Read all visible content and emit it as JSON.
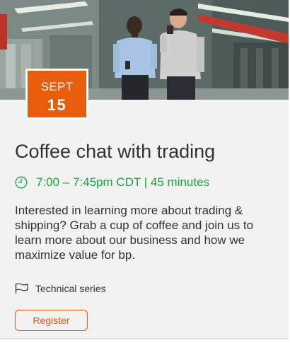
{
  "event": {
    "date": {
      "month": "SEPT",
      "day": "15"
    },
    "title": "Coffee chat with trading",
    "time": "7:00 – 7:45pm CDT | 45 minutes",
    "description": "Interested in learning more about trading & shipping? Grab a cup of coffee and join us to learn more about our business and how we maximize value for bp.",
    "series": "Technical series",
    "register_label": "Register"
  },
  "icons": {
    "time": "clock-icon",
    "series": "flag-icon"
  },
  "colors": {
    "accent_orange": "#e85d0c",
    "time_green": "#17a33a",
    "card_background": "#f2f2f2",
    "text": "#333333"
  }
}
